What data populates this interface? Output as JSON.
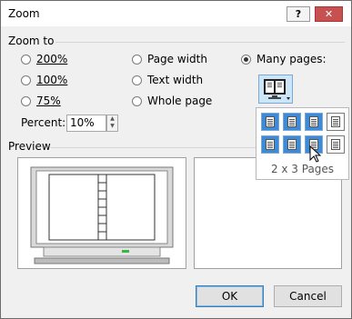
{
  "window": {
    "title": "Zoom",
    "help_label": "?",
    "close_label": "✕"
  },
  "zoom_to": {
    "label": "Zoom to",
    "options": [
      {
        "label": "200%",
        "selected": false
      },
      {
        "label": "100%",
        "selected": false
      },
      {
        "label": "75%",
        "selected": false
      },
      {
        "label": "Page width",
        "selected": false
      },
      {
        "label": "Text width",
        "selected": false
      },
      {
        "label": "Whole page",
        "selected": false
      },
      {
        "label": "Many pages:",
        "selected": true
      }
    ],
    "percent_label": "Percent:",
    "percent_value": "10%"
  },
  "many_pages_popup": {
    "selected_label": "2 x 3 Pages",
    "grid": [
      [
        true,
        true,
        true,
        false
      ],
      [
        true,
        true,
        true,
        false
      ]
    ],
    "highlight_color": "#3d8bd6"
  },
  "preview": {
    "label": "Preview"
  },
  "buttons": {
    "ok": "OK",
    "cancel": "Cancel"
  },
  "icons": [
    "help-icon",
    "close-icon",
    "many-pages-icon",
    "page-icon",
    "spin-up-icon",
    "spin-down-icon",
    "cursor-icon",
    "monitor-icon"
  ]
}
